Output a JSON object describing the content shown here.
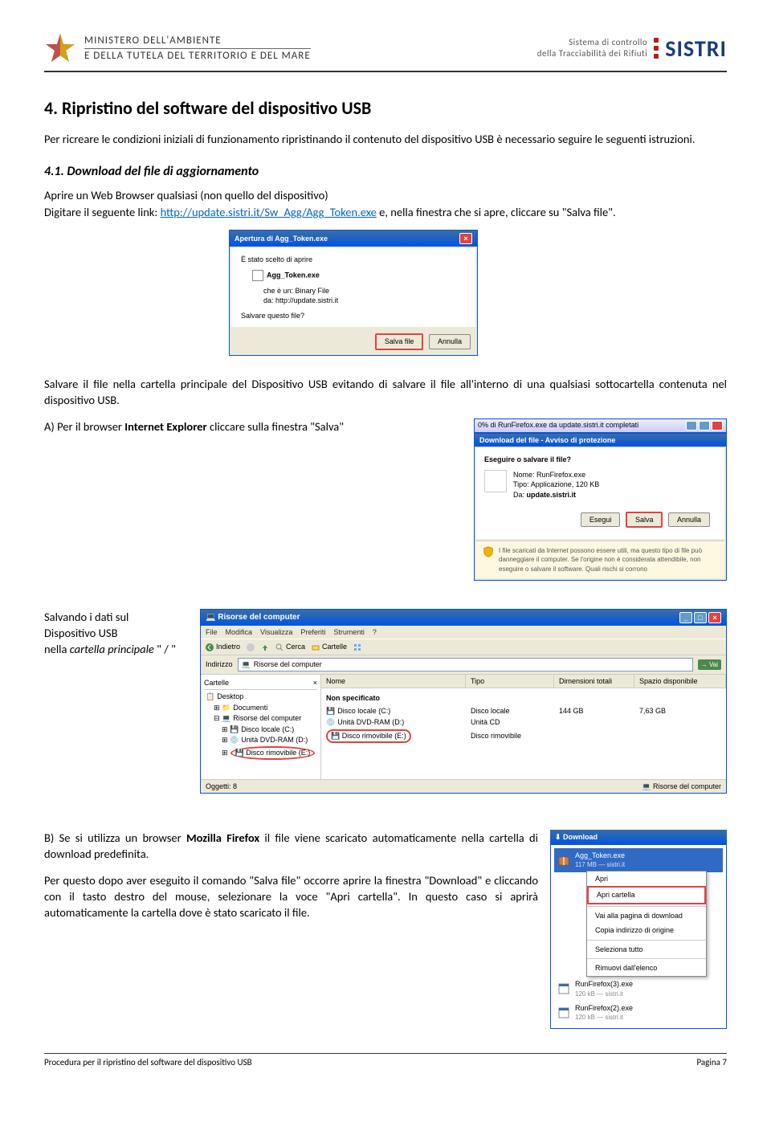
{
  "header": {
    "ministry_line1": "MINISTERO DELL'AMBIENTE",
    "ministry_line2": "E DELLA TUTELA DEL TERRITORIO E DEL MARE",
    "tagline_line1": "Sistema di controllo",
    "tagline_line2": "della Tracciabilità dei Rifiuti",
    "brand": "SISTRI"
  },
  "section": {
    "number": "4.",
    "title": "Ripristino del software del dispositivo USB",
    "intro": "Per ricreare le condizioni iniziali di funzionamento ripristinando il contenuto del dispositivo USB è necessario seguire le seguenti istruzioni.",
    "sub_number": "4.1.",
    "sub_title": "Download del file di aggiornamento",
    "p1_a": "Aprire un Web Browser qualsiasi (non quello del dispositivo)",
    "p1_b": "Digitare il seguente link: ",
    "link": "http://update.sistri.it/Sw_Agg/Agg_Token.exe",
    "p1_c": " e, nella finestra che si apre, cliccare su \"Salva file\".",
    "p2": "Salvare il file nella cartella principale del Dispositivo USB evitando di salvare il file all'interno di una qualsiasi sottocartella contenuta nel dispositivo USB.",
    "pA_label": "A)",
    "pA_text": "Per il browser Internet Explorer cliccare sulla finestra \"Salva\"",
    "pA_bold": "Internet Explorer",
    "save_label1": "Salvando i dati sul Dispositivo USB",
    "save_label2": "nella ",
    "save_label2_i": "cartella principale",
    "save_label3": " \" / \"",
    "pB_label": "B)",
    "pB_text1": "Se si utilizza un browser ",
    "pB_bold": "Mozilla Firefox",
    "pB_text2": " il file viene scaricato automaticamente nella cartella di download predefinita.",
    "pB_text3": "Per questo dopo aver eseguito il comando \"Salva file\" occorre aprire la finestra \"Download\" e cliccando con il tasto destro del mouse, selezionare la voce \"Apri cartella\". In questo caso si aprirà automaticamente la cartella dove è stato scaricato il file."
  },
  "dialog1": {
    "title": "Apertura di Agg_Token.exe",
    "line1": "È stato scelto di aprire",
    "filename": "Agg_Token.exe",
    "type_label": "che è un:",
    "type_value": "Binary File",
    "from_label": "da:",
    "from_value": "http://update.sistri.it",
    "question": "Salvare questo file?",
    "btn_save": "Salva file",
    "btn_cancel": "Annulla"
  },
  "ie_dialog": {
    "progress": "0% di RunFirefox.exe da update.sistri.it completati",
    "title": "Download del file - Avviso di protezione",
    "question": "Eseguire o salvare il file?",
    "name_label": "Nome:",
    "name_value": "RunFirefox.exe",
    "type_label": "Tipo:",
    "type_value": "Applicazione, 120 KB",
    "from_label": "Da:",
    "from_value": "update.sistri.it",
    "btn_run": "Esegui",
    "btn_save": "Salva",
    "btn_cancel": "Annulla",
    "warning": "I file scaricati da Internet possono essere utili, ma questo tipo di file può danneggiare il computer. Se l'origine non è considerata attendibile, non eseguire o salvare il software. Quali rischi si corrono"
  },
  "explorer": {
    "title": "Risorse del computer",
    "menu": [
      "File",
      "Modifica",
      "Visualizza",
      "Preferiti",
      "Strumenti",
      "?"
    ],
    "back": "Indietro",
    "search": "Cerca",
    "folders": "Cartelle",
    "address_label": "Indirizzo",
    "address_value": "Risorse del computer",
    "vai": "Vai",
    "sidebar_header": "Cartelle",
    "tree": {
      "desktop": "Desktop",
      "documents": "Documenti",
      "computer": "Risorse del computer",
      "disk_c": "Disco locale (C:)",
      "dvd": "Unità DVD-RAM (D:)",
      "removable": "Disco rimovibile (E:)"
    },
    "columns": [
      "Nome",
      "Tipo",
      "Dimensioni totali",
      "Spazio disponibile"
    ],
    "section_none": "Non specificato",
    "rows": [
      {
        "name": "Disco locale (C:)",
        "type": "Disco locale",
        "size": "144 GB",
        "free": "7,63 GB"
      },
      {
        "name": "Unità DVD-RAM (D:)",
        "type": "Unità CD",
        "size": "",
        "free": ""
      },
      {
        "name": "Disco rimovibile (E:)",
        "type": "Disco rimovibile",
        "size": "",
        "free": ""
      }
    ],
    "status_left": "Oggetti: 8",
    "status_right": "Risorse del computer"
  },
  "ff": {
    "title": "Download",
    "item1_name": "Agg_Token.exe",
    "item1_sub": "117 MB — sistri.it",
    "menu": [
      "Apri",
      "Apri cartella",
      "Vai alla pagina di download",
      "Copia indirizzo di origine",
      "Seleziona tutto",
      "Rimuovi dall'elenco"
    ],
    "item2_name": "RunFirefox(3).exe",
    "item2_sub": "120 kB — sistri.it",
    "item3_name": "RunFirefox(2).exe",
    "item3_sub": "120 kB — sistri.it",
    "file_suffix_3": "(3)",
    "file_suffix_2": "(2)"
  },
  "footer": {
    "left": "Procedura per il ripristino del software del dispositivo USB",
    "right": "Pagina 7"
  }
}
